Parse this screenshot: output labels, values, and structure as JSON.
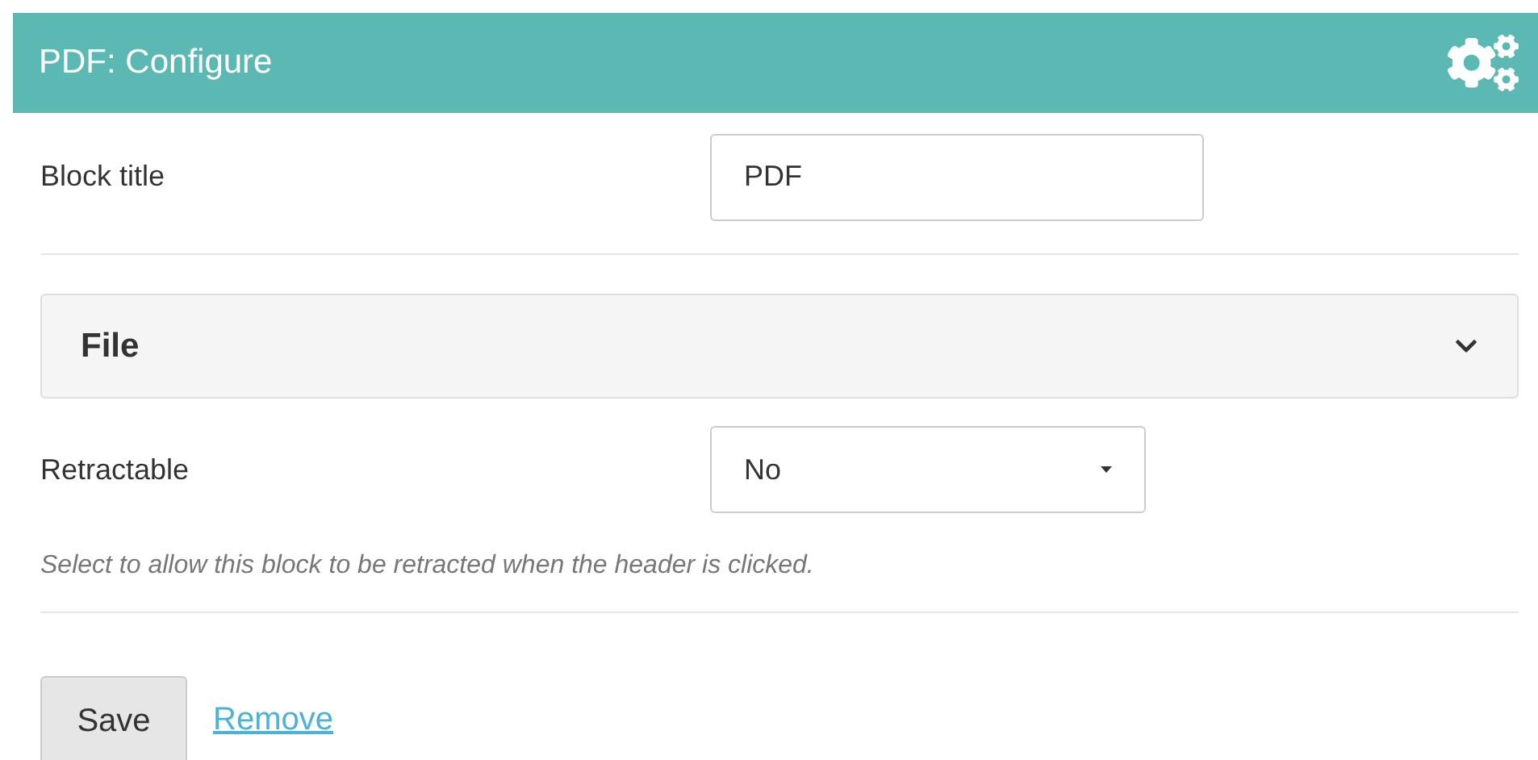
{
  "header": {
    "title": "PDF: Configure"
  },
  "block_title": {
    "label": "Block title",
    "value": "PDF"
  },
  "section": {
    "title": "File",
    "expanded": false
  },
  "retractable": {
    "label": "Retractable",
    "value": "No",
    "help": "Select to allow this block to be retracted when the header is clicked."
  },
  "buttons": {
    "save": "Save",
    "remove": "Remove"
  }
}
